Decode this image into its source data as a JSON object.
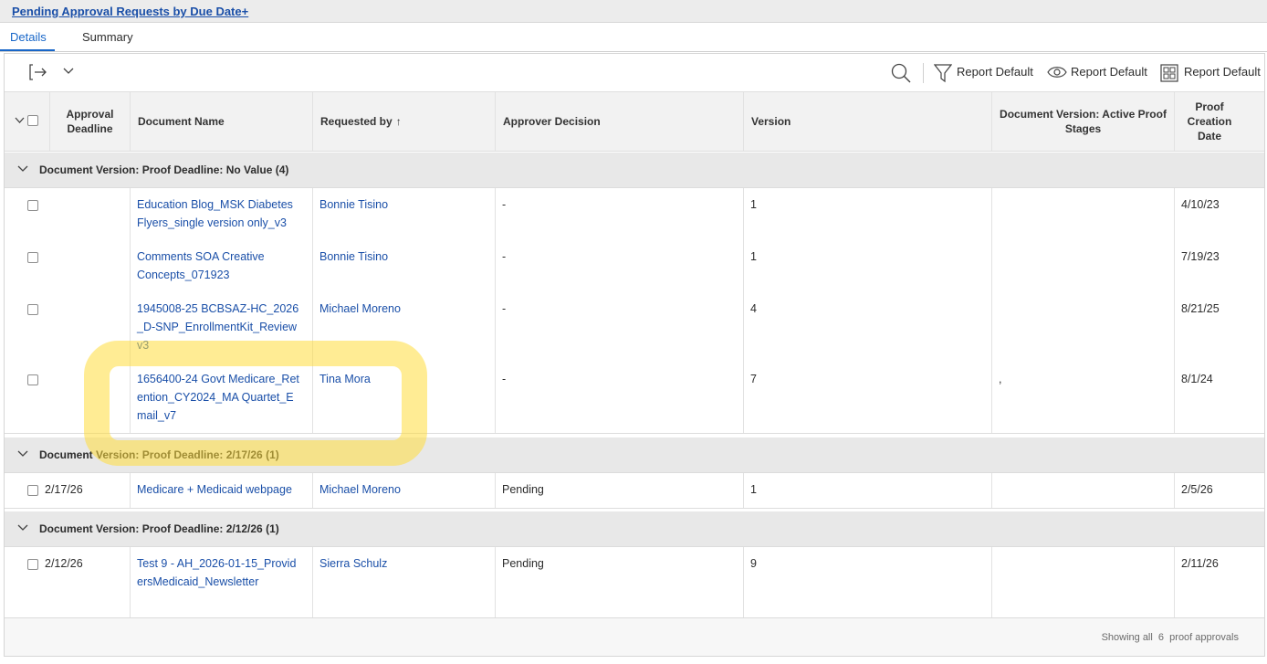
{
  "report": {
    "title": "Pending Approval Requests by Due Date+"
  },
  "tabs": [
    {
      "label": "Details"
    },
    {
      "label": "Summary"
    }
  ],
  "toolbar": {
    "filter_label": "Report Default",
    "view_label": "Report Default",
    "grouping_label": "Report Default"
  },
  "columns": {
    "deadline": "Approval Deadline",
    "doc_name": "Document Name",
    "requested_by": "Requested by",
    "decision": "Approver Decision",
    "version": "Version",
    "stages": "Document Version: Active Proof Stages",
    "created": "Proof Creation Date"
  },
  "sort": {
    "arrow": "↑"
  },
  "groups": [
    {
      "label": "Document Version: Proof Deadline: No Value (4)",
      "rows": [
        {
          "deadline": "",
          "doc_name": "Education Blog_MSK Diabetes Flyers_single version only_v3",
          "requested_by": "Bonnie Tisino",
          "decision": "-",
          "version": "1",
          "stages": "",
          "created": "4/10/23"
        },
        {
          "deadline": "",
          "doc_name": "Comments SOA Creative Concepts_071923",
          "requested_by": "Bonnie Tisino",
          "decision": "-",
          "version": "1",
          "stages": "",
          "created": "7/19/23"
        },
        {
          "deadline": "",
          "doc_name": "1945008-25 BCBSAZ-HC_2026_D-SNP_EnrollmentKit_Review v3",
          "requested_by": "Michael Moreno",
          "decision": "-",
          "version": "4",
          "stages": "",
          "created": "8/21/25"
        },
        {
          "deadline": "",
          "doc_name": "1656400-24 Govt Medicare_Retention_CY2024_MA Quartet_Email_v7",
          "requested_by": "Tina Mora",
          "decision": "-",
          "version": "7",
          "stages": ",",
          "created": "8/1/24"
        }
      ]
    },
    {
      "label": "Document Version: Proof Deadline: 2/17/26 (1)",
      "rows": [
        {
          "deadline": "2/17/26",
          "doc_name": "Medicare + Medicaid webpage",
          "requested_by": "Michael Moreno",
          "decision": "Pending",
          "version": "1",
          "stages": "",
          "created": "2/5/26"
        }
      ]
    },
    {
      "label": "Document Version: Proof Deadline: 2/12/26 (1)",
      "rows": [
        {
          "deadline": "2/12/26",
          "doc_name": "Test 9 - AH_2026-01-15_ProvidersMedicaid_Newsletter",
          "requested_by": "Sierra Schulz",
          "decision": "Pending",
          "version": "9",
          "stages": "",
          "created": "2/11/26"
        }
      ]
    }
  ],
  "footer": {
    "text": "Showing all  6  proof approvals"
  }
}
